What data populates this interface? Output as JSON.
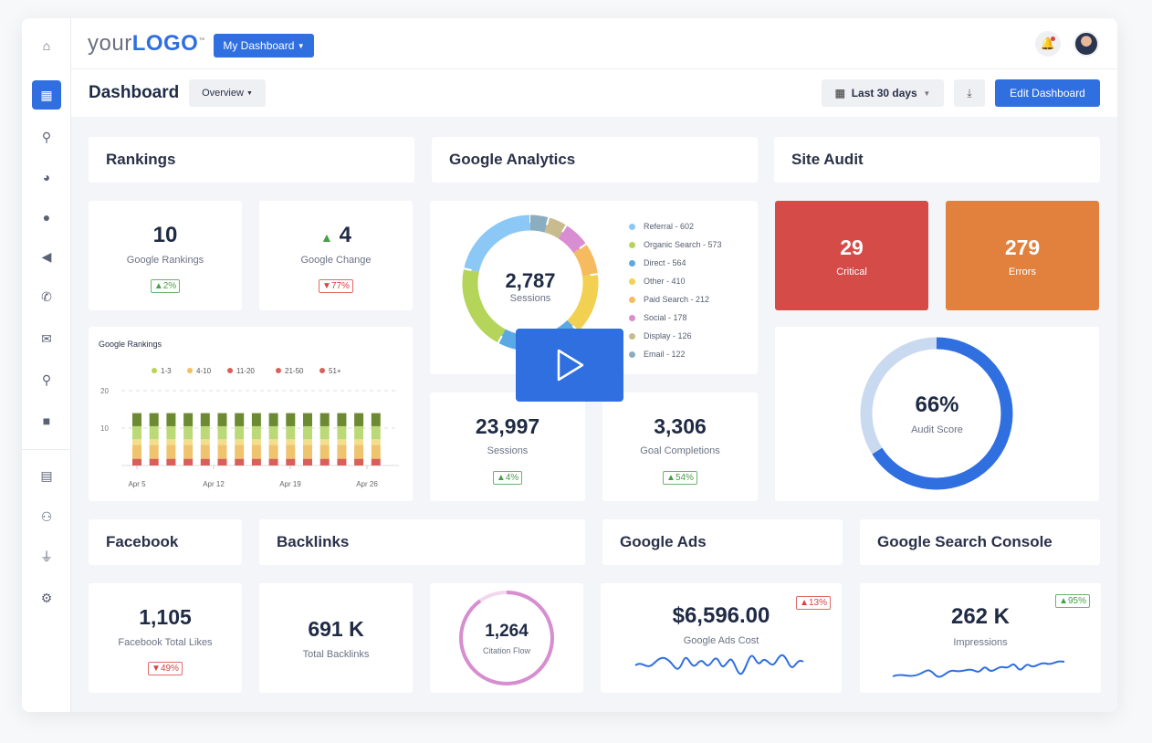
{
  "brand": {
    "logo_light": "your",
    "logo_bold": "LOGO",
    "tm": "™",
    "dashboard_menu": "My Dashboard"
  },
  "header": {
    "title": "Dashboard",
    "view_select": "Overview",
    "date_range": "Last 30 days",
    "edit_button": "Edit Dashboard"
  },
  "sidebar": {
    "icons": [
      "home-icon",
      "dashboard-icon",
      "search-icon",
      "pie-chart-icon",
      "chat-icon",
      "megaphone-icon",
      "phone-icon",
      "mail-icon",
      "location-pin-icon",
      "briefcase-icon",
      "document-icon",
      "users-icon",
      "plug-icon",
      "gear-icon"
    ]
  },
  "sections": {
    "rankings": "Rankings",
    "analytics": "Google Analytics",
    "audit": "Site Audit",
    "facebook": "Facebook",
    "backlinks": "Backlinks",
    "ads": "Google Ads",
    "gsc": "Google Search Console"
  },
  "rankings": {
    "count": "10",
    "count_label": "Google Rankings",
    "count_badge": "2%",
    "change": "4",
    "change_label": "Google Change",
    "change_badge": "77%"
  },
  "chart_data": {
    "type": "bar",
    "stacked": true,
    "title": "Google Rankings",
    "legend": [
      "1-3",
      "4-10",
      "11-20",
      "21-50",
      "51+"
    ],
    "xticks": [
      "Apr 5",
      "Apr 12",
      "Apr 19",
      "Apr 26"
    ],
    "yticks": [
      "10",
      "20"
    ],
    "ylim": [
      0,
      20
    ],
    "bars": 15,
    "segments": [
      {
        "value": 1.8,
        "color": "#d9605a"
      },
      {
        "value": 3.7,
        "color": "#f0c36e"
      },
      {
        "value": 1.5,
        "color": "#f2df8e"
      },
      {
        "value": 3.5,
        "color": "#bcd977"
      },
      {
        "value": 3.5,
        "color": "#6c8a32"
      }
    ],
    "legend_colors": [
      "#b7d64f",
      "#f4bd5e",
      "#d9605a",
      "#d9605a",
      "#d9605a"
    ]
  },
  "analytics": {
    "sessions_total": "2,787",
    "sessions_label": "Sessions",
    "sources": [
      {
        "label": "Referral - 602",
        "value": 602,
        "color": "#8cc8f5"
      },
      {
        "label": "Organic Search - 573",
        "value": 573,
        "color": "#b5d55a"
      },
      {
        "label": "Direct - 564",
        "value": 564,
        "color": "#5aa8e4"
      },
      {
        "label": "Other - 410",
        "value": 410,
        "color": "#f2d052"
      },
      {
        "label": "Paid Search - 212",
        "value": 212,
        "color": "#f5bb5e"
      },
      {
        "label": "Social - 178",
        "value": 178,
        "color": "#d98ed1"
      },
      {
        "label": "Display - 126",
        "value": 126,
        "color": "#c8bc8e"
      },
      {
        "label": "Email - 122",
        "value": 122,
        "color": "#8aaec0"
      }
    ],
    "sessions": "23,997",
    "sessions_sub": "Sessions",
    "sessions_badge": "4%",
    "goals": "3,306",
    "goals_label": "Goal Completions",
    "goals_badge": "54%"
  },
  "audit": {
    "critical": "29",
    "critical_label": "Critical",
    "errors": "279",
    "errors_label": "Errors",
    "score": "66%",
    "score_label": "Audit Score",
    "score_value": 66,
    "critical_color": "#d44b48",
    "errors_color": "#e2813e"
  },
  "facebook": {
    "likes": "1,105",
    "likes_label": "Facebook Total Likes",
    "badge": "49%"
  },
  "backlinks": {
    "total": "691 K",
    "total_label": "Total Backlinks",
    "citation": "1,264",
    "citation_label": "Citation Flow",
    "citation_fill": 90
  },
  "ads": {
    "cost": "$6,596.00",
    "cost_label": "Google Ads Cost",
    "badge": "13%"
  },
  "gsc": {
    "impressions": "262 K",
    "impressions_label": "Impressions",
    "badge": "95%"
  },
  "colors": {
    "accent": "#2f6fe0"
  }
}
